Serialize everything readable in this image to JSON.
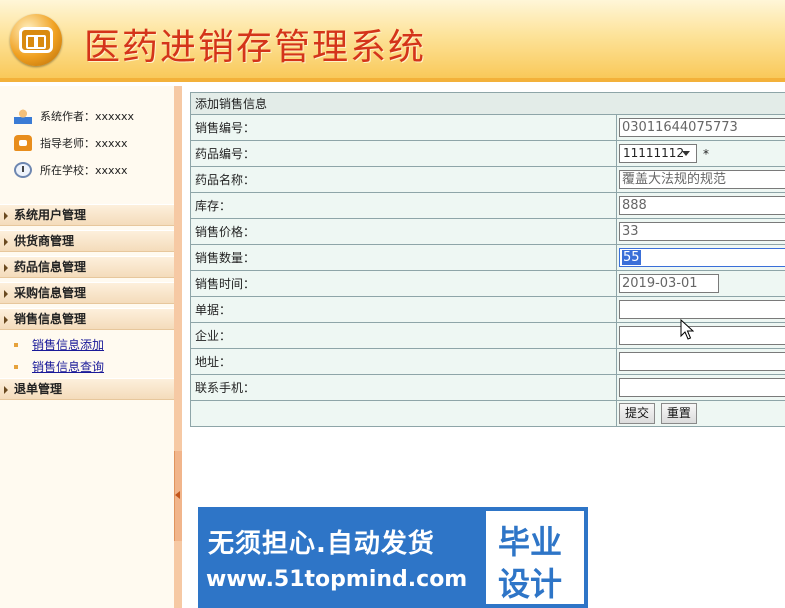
{
  "header": {
    "title": "医药进销存管理系统"
  },
  "sidebar": {
    "info": [
      {
        "label": "系统作者：xxxxxx",
        "icon": "user-icon"
      },
      {
        "label": "指导老师：xxxxx",
        "icon": "phone-icon"
      },
      {
        "label": "所在学校：xxxxx",
        "icon": "clock-icon"
      }
    ],
    "menus": [
      {
        "label": "系统用户管理"
      },
      {
        "label": "供货商管理"
      },
      {
        "label": "药品信息管理"
      },
      {
        "label": "采购信息管理"
      },
      {
        "label": "销售信息管理",
        "sub": [
          "销售信息添加",
          "销售信息查询"
        ]
      },
      {
        "label": "退单管理"
      }
    ]
  },
  "form": {
    "caption": "添加销售信息",
    "rows": [
      {
        "label": "销售编号：",
        "value": "03011644075773"
      },
      {
        "label": "药品编号：",
        "select": "11111112",
        "required_mark": "*"
      },
      {
        "label": "药品名称：",
        "value": "覆盖大法规的规范"
      },
      {
        "label": "库存：",
        "value": "888"
      },
      {
        "label": "销售价格：",
        "value": "33"
      },
      {
        "label": "销售数量：",
        "value": "55"
      },
      {
        "label": "销售时间：",
        "value": "2019-03-01"
      },
      {
        "label": "单据：",
        "value": ""
      },
      {
        "label": "企业：",
        "value": ""
      },
      {
        "label": "地址：",
        "value": ""
      },
      {
        "label": "联系手机：",
        "value": ""
      }
    ],
    "submit_label": "提交",
    "reset_label": "重置"
  },
  "banner": {
    "line1": "无须担心.自动发货",
    "line2": "www.51topmind.com",
    "badge1": "毕业",
    "badge2": "设计"
  },
  "colors": {
    "title": "#d4341a",
    "banner": "#2e75c7",
    "header_bottom": "#f3b13a"
  }
}
